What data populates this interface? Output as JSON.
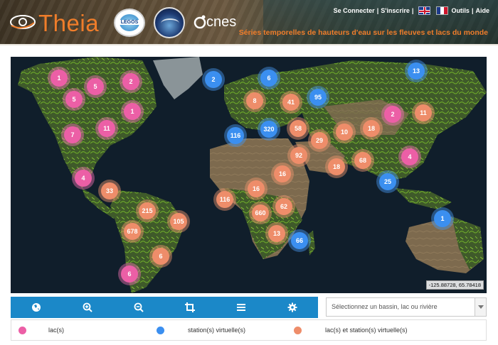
{
  "header": {
    "logo_text": "Theia",
    "cnes_text": "cnes",
    "legos_text": "LEGOS",
    "links": {
      "login": "Se Connecter",
      "register": "S'inscrire",
      "tools": "Outils",
      "help": "Aide"
    },
    "subtitle": "Séries temporelles de hauteurs d'eau sur les fleuves et lacs du monde"
  },
  "map": {
    "coordinates": "-125.88728, 65.78418",
    "clusters": [
      {
        "count": "1",
        "type": "lake"
      },
      {
        "count": "5",
        "type": "lake"
      },
      {
        "count": "2",
        "type": "lake"
      },
      {
        "count": "5",
        "type": "lake"
      },
      {
        "count": "1",
        "type": "lake"
      },
      {
        "count": "7",
        "type": "lake"
      },
      {
        "count": "11",
        "type": "lake"
      },
      {
        "count": "2",
        "type": "station"
      },
      {
        "count": "6",
        "type": "station"
      },
      {
        "count": "13",
        "type": "station"
      },
      {
        "count": "8",
        "type": "both"
      },
      {
        "count": "41",
        "type": "both"
      },
      {
        "count": "95",
        "type": "station"
      },
      {
        "count": "2",
        "type": "lake"
      },
      {
        "count": "11",
        "type": "both"
      },
      {
        "count": "116",
        "type": "station"
      },
      {
        "count": "320",
        "type": "station"
      },
      {
        "count": "58",
        "type": "both"
      },
      {
        "count": "10",
        "type": "both"
      },
      {
        "count": "18",
        "type": "both"
      },
      {
        "count": "29",
        "type": "both"
      },
      {
        "count": "92",
        "type": "both"
      },
      {
        "count": "18",
        "type": "both"
      },
      {
        "count": "68",
        "type": "both"
      },
      {
        "count": "4",
        "type": "lake"
      },
      {
        "count": "4",
        "type": "lake"
      },
      {
        "count": "16",
        "type": "both"
      },
      {
        "count": "25",
        "type": "station"
      },
      {
        "count": "33",
        "type": "both"
      },
      {
        "count": "16",
        "type": "both"
      },
      {
        "count": "116",
        "type": "both"
      },
      {
        "count": "215",
        "type": "both"
      },
      {
        "count": "62",
        "type": "both"
      },
      {
        "count": "660",
        "type": "both"
      },
      {
        "count": "105",
        "type": "both"
      },
      {
        "count": "678",
        "type": "both"
      },
      {
        "count": "1",
        "type": "station"
      },
      {
        "count": "13",
        "type": "both"
      },
      {
        "count": "66",
        "type": "station"
      },
      {
        "count": "6",
        "type": "both"
      },
      {
        "count": "6",
        "type": "lake"
      }
    ]
  },
  "toolbar": {
    "buttons": [
      "globe-icon",
      "zoom-in-icon",
      "zoom-out-icon",
      "crop-icon",
      "menu-icon",
      "gear-icon"
    ]
  },
  "select": {
    "placeholder": "Sélectionnez un bassin, lac ou rivière"
  },
  "legend": {
    "lakes": "lac(s)",
    "stations": "station(s) virtuelle(s)",
    "both": "lac(s) et station(s) virtuelle(s)"
  },
  "colors": {
    "accent": "#f07d2a",
    "toolbar": "#1b88c8",
    "lake": "#ec5fa6",
    "station": "#3b8ff0",
    "both": "#ee8d6a"
  }
}
